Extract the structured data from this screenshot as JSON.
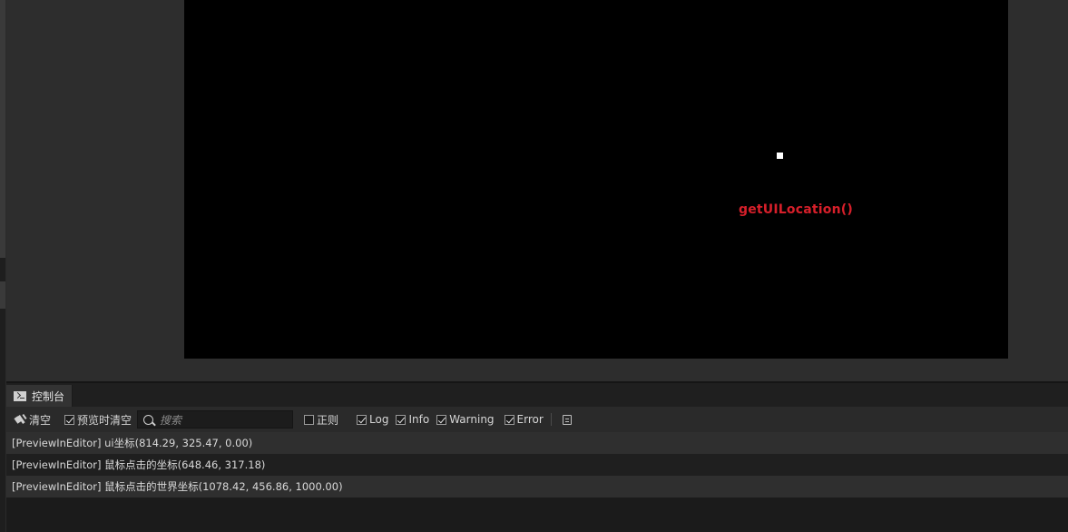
{
  "game": {
    "label": "getUILocation()",
    "label_color": "#d71f2a",
    "background": "#000000"
  },
  "console": {
    "tab_label": "控制台",
    "tab_icon": "terminal-icon"
  },
  "toolbar": {
    "clear_label": "清空",
    "clear_on_preview_label": "预览时清空",
    "clear_on_preview_checked": true,
    "search_placeholder": "搜索",
    "regex_label": "正则",
    "regex_checked": false,
    "filters": [
      {
        "label": "Log",
        "checked": true
      },
      {
        "label": "Info",
        "checked": true
      },
      {
        "label": "Warning",
        "checked": true
      },
      {
        "label": "Error",
        "checked": true
      }
    ]
  },
  "logs": [
    "[PreviewInEditor] ui坐标(814.29, 325.47, 0.00)",
    "[PreviewInEditor] 鼠标点击的坐标(648.46, 317.18)",
    "[PreviewInEditor] 鼠标点击的世界坐标(1078.42, 456.86, 1000.00)"
  ]
}
